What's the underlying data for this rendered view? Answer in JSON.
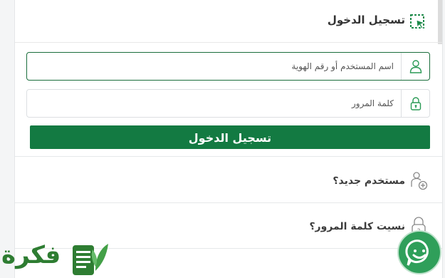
{
  "header": {
    "title": "تسجيل الدخول"
  },
  "form": {
    "username": {
      "placeholder": "اسم المستخدم أو رقم الهوية"
    },
    "password": {
      "placeholder": "كلمة المرور"
    },
    "submit_label": "تسجيل الدخول"
  },
  "links": {
    "new_user": "مستخدم جديد؟",
    "forgot_password": "نسيت كلمة المرور؟"
  },
  "logo": {
    "text": "فكرة"
  },
  "colors": {
    "primary": "#137a42",
    "accent": "#2f9f5a",
    "focus_border": "#1a6e3c"
  },
  "icons": {
    "header": "cursor-select-icon",
    "username": "user-icon",
    "password": "lock-icon",
    "new_user": "add-user-icon",
    "forgot": "lock-question-icon",
    "chat": "chat-smile-icon"
  }
}
